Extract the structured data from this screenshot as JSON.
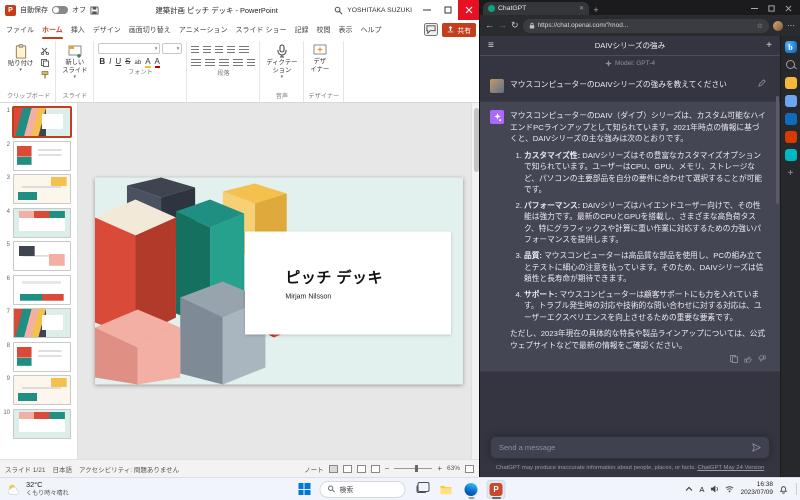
{
  "accents": {
    "powerpoint_red": "#c43e1c",
    "chatgpt_green": "#10a37f",
    "gpt4_purple": "#ab68ff",
    "windows_blue": "#0078d4"
  },
  "powerpoint": {
    "titlebar": {
      "autosave_label": "自動保存",
      "autosave_state": "オフ",
      "title": "建築計画 ピッチ デッキ - PowerPoint",
      "user": "YOSHITAKA SUZUKI"
    },
    "ribbon_tabs": [
      "ファイル",
      "ホーム",
      "挿入",
      "デザイン",
      "画面切り替え",
      "アニメーション",
      "スライド ショー",
      "記録",
      "校閲",
      "表示",
      "ヘルプ"
    ],
    "active_tab": "ホーム",
    "tab_actions": {
      "share": "共有"
    },
    "ribbon": {
      "paste": "貼り付け",
      "new_slide_line1": "新しい",
      "new_slide_line2": "スライド",
      "dictate_line1": "ディクテー",
      "dictate_line2": "ション",
      "designer_line1": "デザ",
      "designer_line2": "イナー",
      "font_buttons": [
        "B",
        "I",
        "U",
        "S",
        "ab"
      ],
      "group_labels": [
        "クリップボード",
        "スライド",
        "フォント",
        "段落",
        "音声",
        "デザイナー"
      ]
    },
    "slides": [
      1,
      2,
      3,
      4,
      5,
      6,
      7,
      8,
      9,
      10
    ],
    "current_slide": 1,
    "slide": {
      "title": "ピッチ デッキ",
      "subtitle": "Mirjam Nilsson"
    },
    "statusbar": {
      "slide_indicator": "スライド 1/21",
      "language": "日本語",
      "accessibility": "アクセシビリティ: 問題ありません",
      "notes": "ノート",
      "zoom": "63%"
    }
  },
  "browser": {
    "tab_title": "ChatGPT",
    "url": "https://chat.openai.com/?mod...",
    "sidebar_icons": [
      "bing-chat",
      "search",
      "shopping",
      "tools",
      "outlook",
      "office",
      "drop",
      "add"
    ],
    "chatgpt": {
      "conversation_title": "DAIVシリーズの強み",
      "model_label": "Model: GPT-4",
      "user_message": "マウスコンピューターのDAIVシリーズの強みを教えてください",
      "assistant_intro": "マウスコンピューターのDAIV（ダイブ）シリーズは、カスタム可能なハイエンドPCラインアップとして知られています。2021年時点の情報に基づくと、DAIVシリーズの主な強みは次のとおりです。",
      "list": [
        {
          "label": "カスタマイズ性",
          "text": "DAIVシリーズはその豊富なカスタマイズオプションで知られています。ユーザーはCPU、GPU、メモリ、ストレージなど、パソコンの主要部品を自分の要件に合わせて選択することが可能です。"
        },
        {
          "label": "パフォーマンス",
          "text": "DAIVシリーズはハイエンドユーザー向けで、その性能は強力です。最新のCPUとGPUを搭載し、さまざまな高負荷タスク、特にグラフィックスや計算に重い作業に対応するための力強いパフォーマンスを提供します。"
        },
        {
          "label": "品質",
          "text": "マウスコンピューターは高品質な部品を使用し、PCの組み立てとテストに細心の注意を払っています。そのため、DAIVシリーズは信頼性と長寿命が期待できます。"
        },
        {
          "label": "サポート",
          "text": "マウスコンピューターは顧客サポートにも力を入れています。トラブル発生時の対応や技術的な問い合わせに対する対応は、ユーザーエクスペリエンスを向上させるための重要な要素です。"
        }
      ],
      "assistant_outro": "ただし、2023年現在の具体的な特長や製品ラインアップについては、公式ウェブサイトなどで最新の情報をご確認ください。",
      "input_placeholder": "Send a message",
      "footer_text": "ChatGPT may produce inaccurate information about people, places, or facts.",
      "footer_link": "ChatGPT May 24 Version"
    }
  },
  "taskbar": {
    "weather": {
      "temp": "32°C",
      "condition": "くもり時々晴れ"
    },
    "search_label": "検索",
    "tray": {
      "ime": "A",
      "time": "16:38",
      "date": "2023/07/09"
    }
  }
}
